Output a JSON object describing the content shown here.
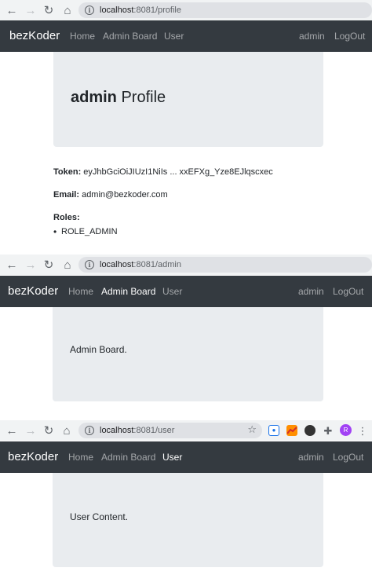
{
  "brand": "bezKoder",
  "nav": {
    "home": "Home",
    "admin_board": "Admin Board",
    "user": "User",
    "username": "admin",
    "logout": "LogOut"
  },
  "screens": {
    "profile": {
      "url_host": "localhost",
      "url_path": ":8081/profile",
      "title_bold": "admin",
      "title_rest": " Profile",
      "token_label": "Token:",
      "token_value": " eyJhbGciOiJIUzI1NiIs ... xxEFXg_Yze8EJlqscxec",
      "email_label": "Email:",
      "email_value": " admin@bezkoder.com",
      "roles_label": "Roles:",
      "roles": [
        "ROLE_ADMIN"
      ]
    },
    "admin": {
      "url_host": "localhost",
      "url_path": ":8081/admin",
      "content": "Admin Board."
    },
    "user": {
      "url_host": "localhost",
      "url_path": ":8081/user",
      "content": "User Content.",
      "avatar_letter": "R"
    }
  },
  "icons": {
    "back": "back-arrow-icon",
    "forward": "forward-arrow-icon",
    "reload": "reload-icon",
    "home": "home-icon",
    "info": "info-icon",
    "star": "star-icon",
    "puzzle": "puzzle-extension-icon",
    "more": "more-vertical-icon"
  },
  "colors": {
    "navbar": "#343a40",
    "jumbotron": "#e9ecef",
    "avatar": "#a142f4"
  }
}
